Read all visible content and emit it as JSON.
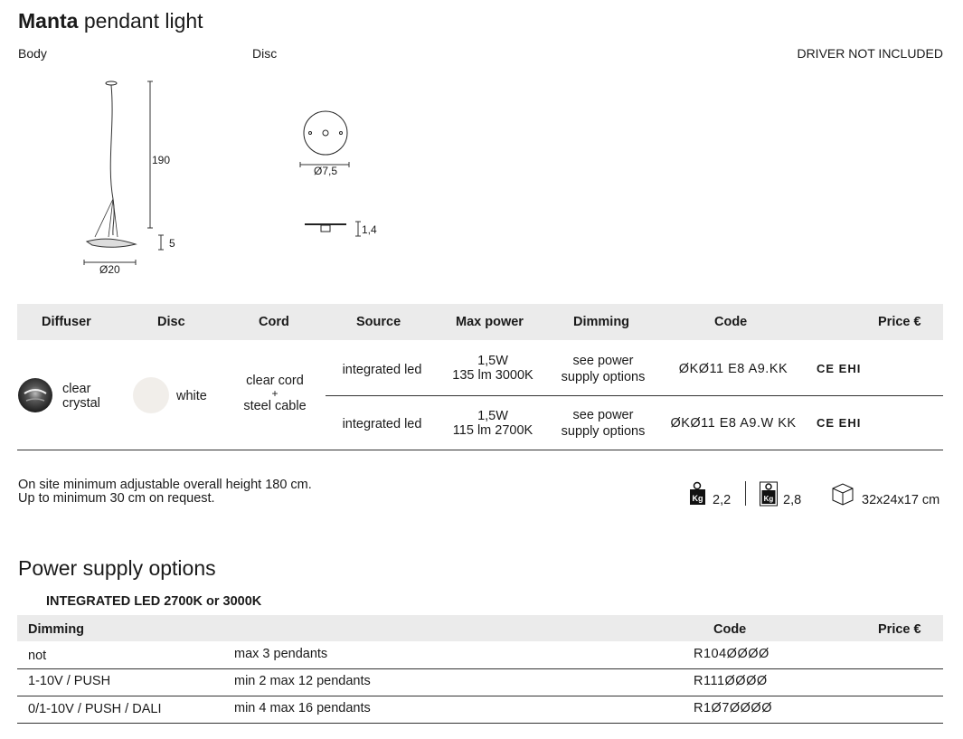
{
  "product": {
    "name_bold": "Manta",
    "name_rest": "pendant light"
  },
  "labels": {
    "body": "Body",
    "disc": "Disc",
    "driver_note": "DRIVER NOT INCLUDED"
  },
  "dimensions": {
    "height": "190",
    "body_height": "5",
    "body_diameter": "Ø20",
    "disc_diameter": "Ø7,5",
    "disc_height": "1,4"
  },
  "table": {
    "headers": {
      "diffuser": "Diffuser",
      "disc": "Disc",
      "cord": "Cord",
      "source": "Source",
      "max_power": "Max power",
      "dimming": "Dimming",
      "code": "Code",
      "price": "Price €"
    },
    "diffuser": {
      "line1": "clear",
      "line2": "crystal"
    },
    "disc": "white",
    "cord": {
      "line1": "clear cord",
      "line2": "+",
      "line3": "steel cable"
    },
    "rows": [
      {
        "source": "integrated led",
        "power1": "1,5W",
        "power2": "135 lm 3000K",
        "dim1": "see power",
        "dim2": "supply options",
        "code": "ØKØ11 E8 A9.KK",
        "marks": "CE EHI"
      },
      {
        "source": "integrated led",
        "power1": "1,5W",
        "power2": "115 lm 2700K",
        "dim1": "see power",
        "dim2": "supply options",
        "code": "ØKØ11 E8 A9.W KK",
        "marks": "CE EHI"
      }
    ]
  },
  "notes": {
    "line1": "On site minimum adjustable overall height 180 cm.",
    "line2": "Up to minimum 30 cm on request."
  },
  "packaging": {
    "net_weight": "2,2",
    "gross_weight": "2,8",
    "box_size": "32x24x17 cm",
    "kg_symbol": "Kg"
  },
  "power_supply": {
    "title": "Power supply options",
    "subtitle": "INTEGRATED LED 2700K or 3000K",
    "headers": {
      "dimming": "Dimming",
      "code": "Code",
      "price": "Price €"
    },
    "rows": [
      {
        "dimming": "not",
        "limit": "max 3 pendants",
        "code": "R104ØØØØ"
      },
      {
        "dimming": "1-10V / PUSH",
        "limit": "min 2 max 12 pendants",
        "code": "R111ØØØØ"
      },
      {
        "dimming": "0/1-10V / PUSH / DALI",
        "limit": "min 4 max 16 pendants",
        "code": "R1Ø7ØØØØ"
      }
    ]
  }
}
